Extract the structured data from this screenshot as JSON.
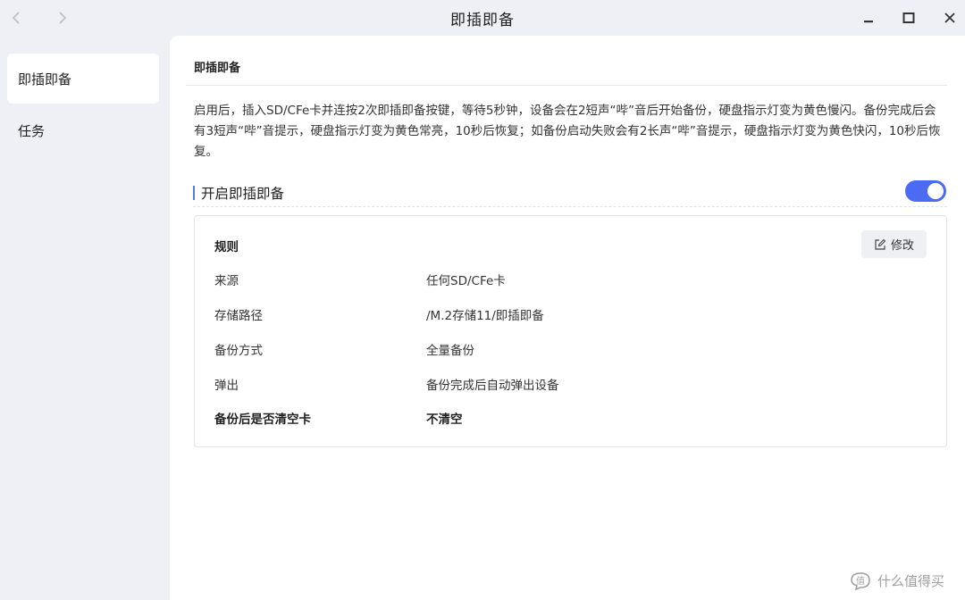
{
  "window": {
    "title": "即插即备"
  },
  "sidebar": {
    "items": [
      {
        "label": "即插即备",
        "active": true
      },
      {
        "label": "任务",
        "active": false
      }
    ]
  },
  "main": {
    "header": "即插即备",
    "description": "启用后，插入SD/CFe卡并连按2次即插即备按键，等待5秒钟，设备会在2短声“哔”音后开始备份，硬盘指示灯变为黄色慢闪。备份完成后会有3短声“哔”音提示，硬盘指示灯变为黄色常亮，10秒后恢复；如备份启动失败会有2长声“哔”音提示，硬盘指示灯变为黄色快闪，10秒后恢复。",
    "section": {
      "title": "开启即插即备",
      "toggle_on": true
    },
    "rules": {
      "title": "规则",
      "edit_label": "修改",
      "rows": [
        {
          "label": "来源",
          "value": "任何SD/CFe卡"
        },
        {
          "label": "存储路径",
          "value": "/M.2存储11/即插即备"
        },
        {
          "label": "备份方式",
          "value": "全量备份"
        },
        {
          "label": "弹出",
          "value": "备份完成后自动弹出设备"
        },
        {
          "label": "备份后是否清空卡",
          "value": "不清空"
        }
      ]
    }
  },
  "watermark": {
    "text": "什么值得买"
  },
  "colors": {
    "accent": "#4b6cf2",
    "background": "#eef0f5",
    "panel": "#ffffff"
  }
}
